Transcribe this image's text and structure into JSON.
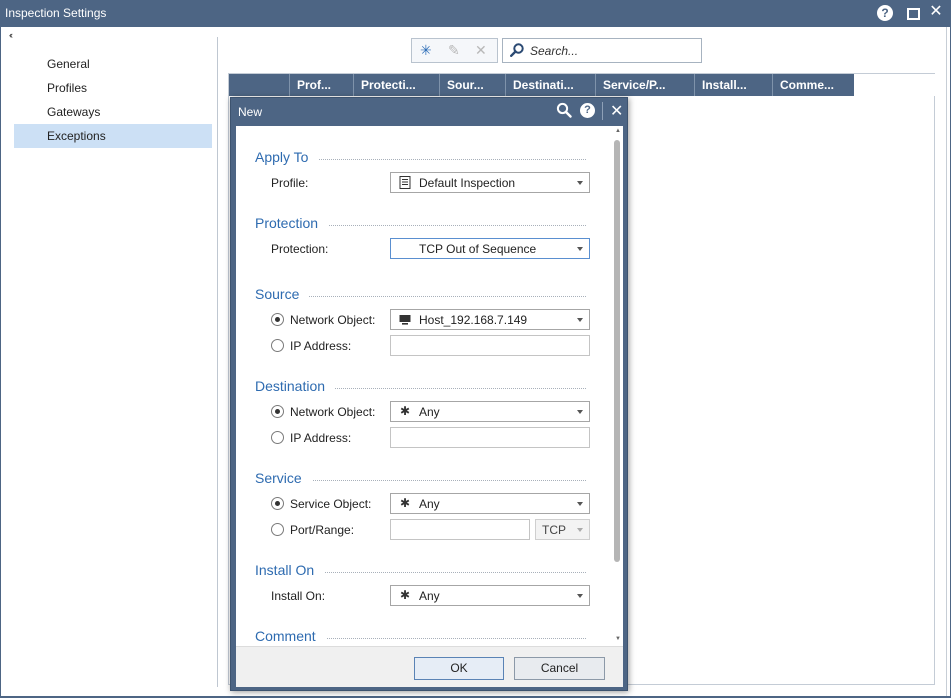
{
  "window": {
    "title": "Inspection Settings",
    "help_glyph": "?",
    "close_glyph": "✕",
    "collapse_glyph": "‹‹"
  },
  "sidebar": {
    "items": [
      {
        "label": "General"
      },
      {
        "label": "Profiles"
      },
      {
        "label": "Gateways"
      },
      {
        "label": "Exceptions",
        "active": true
      }
    ]
  },
  "toolbar": {
    "new_glyph": "✳",
    "edit_glyph": "✎",
    "delete_glyph": "✕"
  },
  "search": {
    "placeholder": "Search..."
  },
  "grid": {
    "columns": [
      "",
      "Prof...",
      "Protecti...",
      "Sour...",
      "Destinati...",
      "Service/P...",
      "Install...",
      "Comme..."
    ]
  },
  "dialog": {
    "title": "New",
    "help_glyph": "?",
    "close_glyph": "✕",
    "sections": {
      "apply_to": {
        "title": "Apply To",
        "profile_label": "Profile:",
        "profile_value": "Default Inspection"
      },
      "protection": {
        "title": "Protection",
        "protection_label": "Protection:",
        "protection_value": "TCP Out of Sequence"
      },
      "source": {
        "title": "Source",
        "network_object_label": "Network Object:",
        "network_object_value": "Host_192.168.7.149",
        "ip_address_label": "IP Address:",
        "selected": "network_object"
      },
      "destination": {
        "title": "Destination",
        "network_object_label": "Network Object:",
        "network_object_value": "Any",
        "ip_address_label": "IP Address:",
        "selected": "network_object"
      },
      "service": {
        "title": "Service",
        "service_object_label": "Service Object:",
        "service_object_value": "Any",
        "port_range_label": "Port/Range:",
        "protocol_value": "TCP",
        "selected": "service_object"
      },
      "install_on": {
        "title": "Install On",
        "install_on_label": "Install On:",
        "install_on_value": "Any"
      },
      "comment": {
        "title": "Comment"
      }
    },
    "any_glyph": "✱",
    "ok_label": "OK",
    "cancel_label": "Cancel"
  },
  "colors": {
    "title_bar": "#4d6584",
    "section_title": "#2e6bb0",
    "nav_active": "#cce0f5"
  }
}
